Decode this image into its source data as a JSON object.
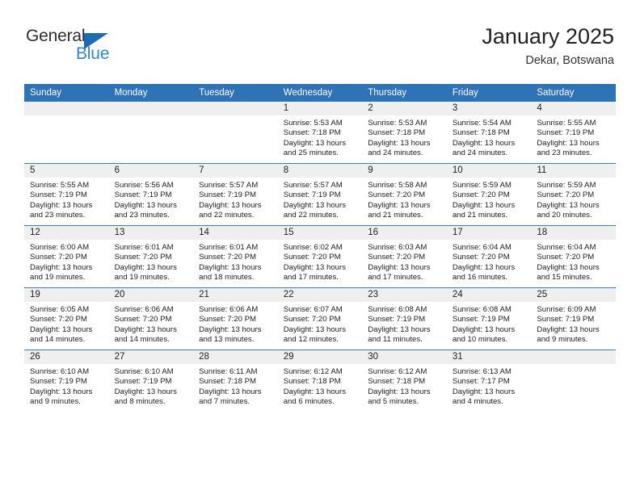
{
  "brand": {
    "name_top": "General",
    "name_bottom": "Blue",
    "triangle_icon": "triangle-icon",
    "color_dark": "#2e2e2e",
    "color_blue": "#2e86d4",
    "color_triangle": "#1b6cb5"
  },
  "header": {
    "title": "January 2025",
    "subtitle": "Dekar, Botswana"
  },
  "theme": {
    "header_row_bg": "#2e72b8",
    "header_row_text": "#ffffff",
    "day_strip_bg": "#efefef",
    "row_divider": "#3a7cbe",
    "cell_bg": "#ffffff"
  },
  "calendar": {
    "weekday_headers": [
      "Sunday",
      "Monday",
      "Tuesday",
      "Wednesday",
      "Thursday",
      "Friday",
      "Saturday"
    ],
    "weeks": [
      [
        {
          "day": "",
          "sunrise": "",
          "sunset": "",
          "daylight_line1": "",
          "daylight_line2": ""
        },
        {
          "day": "",
          "sunrise": "",
          "sunset": "",
          "daylight_line1": "",
          "daylight_line2": ""
        },
        {
          "day": "",
          "sunrise": "",
          "sunset": "",
          "daylight_line1": "",
          "daylight_line2": ""
        },
        {
          "day": "1",
          "sunrise": "Sunrise: 5:53 AM",
          "sunset": "Sunset: 7:18 PM",
          "daylight_line1": "Daylight: 13 hours",
          "daylight_line2": "and 25 minutes."
        },
        {
          "day": "2",
          "sunrise": "Sunrise: 5:53 AM",
          "sunset": "Sunset: 7:18 PM",
          "daylight_line1": "Daylight: 13 hours",
          "daylight_line2": "and 24 minutes."
        },
        {
          "day": "3",
          "sunrise": "Sunrise: 5:54 AM",
          "sunset": "Sunset: 7:18 PM",
          "daylight_line1": "Daylight: 13 hours",
          "daylight_line2": "and 24 minutes."
        },
        {
          "day": "4",
          "sunrise": "Sunrise: 5:55 AM",
          "sunset": "Sunset: 7:19 PM",
          "daylight_line1": "Daylight: 13 hours",
          "daylight_line2": "and 23 minutes."
        }
      ],
      [
        {
          "day": "5",
          "sunrise": "Sunrise: 5:55 AM",
          "sunset": "Sunset: 7:19 PM",
          "daylight_line1": "Daylight: 13 hours",
          "daylight_line2": "and 23 minutes."
        },
        {
          "day": "6",
          "sunrise": "Sunrise: 5:56 AM",
          "sunset": "Sunset: 7:19 PM",
          "daylight_line1": "Daylight: 13 hours",
          "daylight_line2": "and 23 minutes."
        },
        {
          "day": "7",
          "sunrise": "Sunrise: 5:57 AM",
          "sunset": "Sunset: 7:19 PM",
          "daylight_line1": "Daylight: 13 hours",
          "daylight_line2": "and 22 minutes."
        },
        {
          "day": "8",
          "sunrise": "Sunrise: 5:57 AM",
          "sunset": "Sunset: 7:19 PM",
          "daylight_line1": "Daylight: 13 hours",
          "daylight_line2": "and 22 minutes."
        },
        {
          "day": "9",
          "sunrise": "Sunrise: 5:58 AM",
          "sunset": "Sunset: 7:20 PM",
          "daylight_line1": "Daylight: 13 hours",
          "daylight_line2": "and 21 minutes."
        },
        {
          "day": "10",
          "sunrise": "Sunrise: 5:59 AM",
          "sunset": "Sunset: 7:20 PM",
          "daylight_line1": "Daylight: 13 hours",
          "daylight_line2": "and 21 minutes."
        },
        {
          "day": "11",
          "sunrise": "Sunrise: 5:59 AM",
          "sunset": "Sunset: 7:20 PM",
          "daylight_line1": "Daylight: 13 hours",
          "daylight_line2": "and 20 minutes."
        }
      ],
      [
        {
          "day": "12",
          "sunrise": "Sunrise: 6:00 AM",
          "sunset": "Sunset: 7:20 PM",
          "daylight_line1": "Daylight: 13 hours",
          "daylight_line2": "and 19 minutes."
        },
        {
          "day": "13",
          "sunrise": "Sunrise: 6:01 AM",
          "sunset": "Sunset: 7:20 PM",
          "daylight_line1": "Daylight: 13 hours",
          "daylight_line2": "and 19 minutes."
        },
        {
          "day": "14",
          "sunrise": "Sunrise: 6:01 AM",
          "sunset": "Sunset: 7:20 PM",
          "daylight_line1": "Daylight: 13 hours",
          "daylight_line2": "and 18 minutes."
        },
        {
          "day": "15",
          "sunrise": "Sunrise: 6:02 AM",
          "sunset": "Sunset: 7:20 PM",
          "daylight_line1": "Daylight: 13 hours",
          "daylight_line2": "and 17 minutes."
        },
        {
          "day": "16",
          "sunrise": "Sunrise: 6:03 AM",
          "sunset": "Sunset: 7:20 PM",
          "daylight_line1": "Daylight: 13 hours",
          "daylight_line2": "and 17 minutes."
        },
        {
          "day": "17",
          "sunrise": "Sunrise: 6:04 AM",
          "sunset": "Sunset: 7:20 PM",
          "daylight_line1": "Daylight: 13 hours",
          "daylight_line2": "and 16 minutes."
        },
        {
          "day": "18",
          "sunrise": "Sunrise: 6:04 AM",
          "sunset": "Sunset: 7:20 PM",
          "daylight_line1": "Daylight: 13 hours",
          "daylight_line2": "and 15 minutes."
        }
      ],
      [
        {
          "day": "19",
          "sunrise": "Sunrise: 6:05 AM",
          "sunset": "Sunset: 7:20 PM",
          "daylight_line1": "Daylight: 13 hours",
          "daylight_line2": "and 14 minutes."
        },
        {
          "day": "20",
          "sunrise": "Sunrise: 6:06 AM",
          "sunset": "Sunset: 7:20 PM",
          "daylight_line1": "Daylight: 13 hours",
          "daylight_line2": "and 14 minutes."
        },
        {
          "day": "21",
          "sunrise": "Sunrise: 6:06 AM",
          "sunset": "Sunset: 7:20 PM",
          "daylight_line1": "Daylight: 13 hours",
          "daylight_line2": "and 13 minutes."
        },
        {
          "day": "22",
          "sunrise": "Sunrise: 6:07 AM",
          "sunset": "Sunset: 7:20 PM",
          "daylight_line1": "Daylight: 13 hours",
          "daylight_line2": "and 12 minutes."
        },
        {
          "day": "23",
          "sunrise": "Sunrise: 6:08 AM",
          "sunset": "Sunset: 7:19 PM",
          "daylight_line1": "Daylight: 13 hours",
          "daylight_line2": "and 11 minutes."
        },
        {
          "day": "24",
          "sunrise": "Sunrise: 6:08 AM",
          "sunset": "Sunset: 7:19 PM",
          "daylight_line1": "Daylight: 13 hours",
          "daylight_line2": "and 10 minutes."
        },
        {
          "day": "25",
          "sunrise": "Sunrise: 6:09 AM",
          "sunset": "Sunset: 7:19 PM",
          "daylight_line1": "Daylight: 13 hours",
          "daylight_line2": "and 9 minutes."
        }
      ],
      [
        {
          "day": "26",
          "sunrise": "Sunrise: 6:10 AM",
          "sunset": "Sunset: 7:19 PM",
          "daylight_line1": "Daylight: 13 hours",
          "daylight_line2": "and 9 minutes."
        },
        {
          "day": "27",
          "sunrise": "Sunrise: 6:10 AM",
          "sunset": "Sunset: 7:19 PM",
          "daylight_line1": "Daylight: 13 hours",
          "daylight_line2": "and 8 minutes."
        },
        {
          "day": "28",
          "sunrise": "Sunrise: 6:11 AM",
          "sunset": "Sunset: 7:18 PM",
          "daylight_line1": "Daylight: 13 hours",
          "daylight_line2": "and 7 minutes."
        },
        {
          "day": "29",
          "sunrise": "Sunrise: 6:12 AM",
          "sunset": "Sunset: 7:18 PM",
          "daylight_line1": "Daylight: 13 hours",
          "daylight_line2": "and 6 minutes."
        },
        {
          "day": "30",
          "sunrise": "Sunrise: 6:12 AM",
          "sunset": "Sunset: 7:18 PM",
          "daylight_line1": "Daylight: 13 hours",
          "daylight_line2": "and 5 minutes."
        },
        {
          "day": "31",
          "sunrise": "Sunrise: 6:13 AM",
          "sunset": "Sunset: 7:17 PM",
          "daylight_line1": "Daylight: 13 hours",
          "daylight_line2": "and 4 minutes."
        },
        {
          "day": "",
          "sunrise": "",
          "sunset": "",
          "daylight_line1": "",
          "daylight_line2": ""
        }
      ]
    ]
  }
}
